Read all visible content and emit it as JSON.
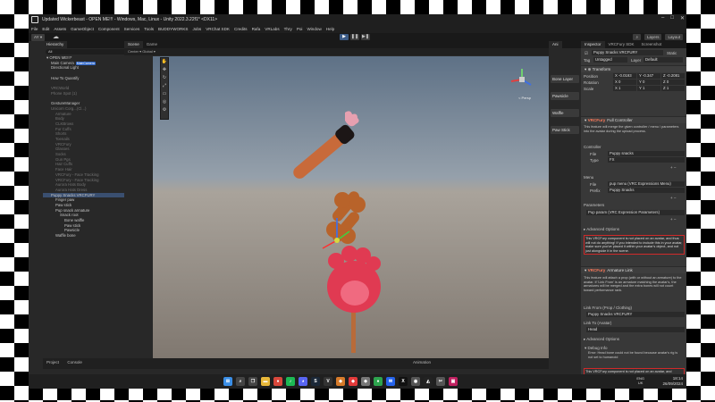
{
  "window": {
    "title": "Updated Wickerbeast - OPEN ME!!! - Windows, Mac, Linux - Unity 2022.3.22f1* <DX11>",
    "controls": [
      "–",
      "□",
      "✕"
    ]
  },
  "menu": [
    "File",
    "Edit",
    "Assets",
    "GameObject",
    "Component",
    "Services",
    "Tools",
    "BUDDYWORKS",
    "Jobs",
    "VRChat SDK",
    "Credits",
    "Rafa",
    "VRLabs",
    "Thry",
    "Poi",
    "Window",
    "Help"
  ],
  "toolbar": {
    "account": "AY ▾",
    "layers": "Layers",
    "layout": "Layout"
  },
  "hierarchy": {
    "tabs": [
      "Hierarchy"
    ],
    "search_placeholder": "All",
    "rows": [
      {
        "label": "▾ OPEN ME!!!*",
        "indent": 0,
        "dim": false,
        "badge": ""
      },
      {
        "label": "Main Camera",
        "indent": 1,
        "dim": false,
        "badge": "MainCamera"
      },
      {
        "label": "Directional Light",
        "indent": 1,
        "dim": false,
        "badge": ""
      },
      {
        "label": "",
        "indent": 1,
        "dim": true,
        "badge": ""
      },
      {
        "label": "How To Quantify",
        "indent": 1,
        "dim": false,
        "badge": ""
      },
      {
        "label": "",
        "indent": 1,
        "dim": true,
        "badge": ""
      },
      {
        "label": "VRCWorld",
        "indent": 1,
        "dim": true,
        "badge": ""
      },
      {
        "label": "Phone Spot (1)",
        "indent": 1,
        "dim": true,
        "badge": ""
      },
      {
        "label": "",
        "indent": 1,
        "dim": true,
        "badge": ""
      },
      {
        "label": "GestureManager",
        "indent": 1,
        "dim": false,
        "badge": ""
      },
      {
        "label": "Unicorn Corg...(Cl...)",
        "indent": 1,
        "dim": true,
        "badge": ""
      },
      {
        "label": "Armature",
        "indent": 2,
        "dim": true,
        "badge": ""
      },
      {
        "label": "Body",
        "indent": 2,
        "dim": true,
        "badge": ""
      },
      {
        "label": "CLKBrows",
        "indent": 2,
        "dim": true,
        "badge": ""
      },
      {
        "label": "Fur Cuffs",
        "indent": 2,
        "dim": true,
        "badge": ""
      },
      {
        "label": "Shorts",
        "indent": 2,
        "dim": true,
        "badge": ""
      },
      {
        "label": "Toenails",
        "indent": 2,
        "dim": true,
        "badge": ""
      },
      {
        "label": "VRCFury",
        "indent": 2,
        "dim": true,
        "badge": ""
      },
      {
        "label": "Glasses",
        "indent": 2,
        "dim": true,
        "badge": ""
      },
      {
        "label": "Socks",
        "indent": 2,
        "dim": true,
        "badge": ""
      },
      {
        "label": "Gun Pgs",
        "indent": 2,
        "dim": true,
        "badge": ""
      },
      {
        "label": "Hair Cuffs",
        "indent": 2,
        "dim": true,
        "badge": ""
      },
      {
        "label": "Face Hair",
        "indent": 2,
        "dim": true,
        "badge": ""
      },
      {
        "label": "VRCFury - Face Tracking",
        "indent": 2,
        "dim": true,
        "badge": ""
      },
      {
        "label": "VRCFury - Face Tracking",
        "indent": 2,
        "dim": true,
        "badge": ""
      },
      {
        "label": "Aurora Hats Body",
        "indent": 2,
        "dim": true,
        "badge": ""
      },
      {
        "label": "Aurora Hats Dress",
        "indent": 2,
        "dim": true,
        "badge": ""
      },
      {
        "label": "Puppy Snacks VRCFURY",
        "indent": 1,
        "dim": false,
        "badge": "",
        "selected": true
      },
      {
        "label": "Finger paw",
        "indent": 2,
        "dim": false,
        "badge": ""
      },
      {
        "label": "Paw stick",
        "indent": 2,
        "dim": false,
        "badge": ""
      },
      {
        "label": "Pup snack armature",
        "indent": 2,
        "dim": false,
        "badge": ""
      },
      {
        "label": "Snack root",
        "indent": 3,
        "dim": false,
        "badge": ""
      },
      {
        "label": "Bone waffle",
        "indent": 4,
        "dim": false,
        "badge": ""
      },
      {
        "label": "Paw stick",
        "indent": 4,
        "dim": false,
        "badge": ""
      },
      {
        "label": "Pawsicle",
        "indent": 4,
        "dim": false,
        "badge": ""
      },
      {
        "label": "Waffle bone",
        "indent": 2,
        "dim": false,
        "badge": ""
      }
    ]
  },
  "scene": {
    "tabs": [
      "Scene",
      "Game"
    ],
    "toolbar_text": "Center ▾   Global ▾",
    "persp_label": "< Persp"
  },
  "side_buttons": [
    "Bone Layer",
    "Pawsicle",
    "Waffle",
    "Paw Stick"
  ],
  "inspector": {
    "tabs": [
      "Inspector",
      "VRCFury SDK",
      "Screenshot"
    ],
    "object_name": "Puppy Snacks VRCFURY",
    "static_label": "Static",
    "tag_label": "Tag",
    "tag_value": "Untagged",
    "layer_label": "Layer",
    "layer_value": "Default",
    "transform": {
      "title": "Transform",
      "position": {
        "label": "Position",
        "x": "X -0.0193",
        "y": "Y -0.347",
        "z": "Z -0.2081"
      },
      "rotation": {
        "label": "Rotation",
        "x": "X 0",
        "y": "Y 0",
        "z": "Z 0"
      },
      "scale": {
        "label": "Scale",
        "x": "X 1",
        "y": "Y 1",
        "z": "Z 1"
      }
    },
    "fc": {
      "tag": "VRCFury",
      "title": "Full Controller",
      "desc": "This feature will merge the given controller / menu / parameters into the avatar during the upload process.",
      "controller_label": "Controller",
      "file_label": "File",
      "file_value": "Puppy snacks",
      "type_label": "Type",
      "type_value": "FX",
      "menu_label": "Menu",
      "menu_file": "pup menu (VRC Expressions Menu)",
      "prefix_label": "Prefix",
      "prefix_value": "Puppy Snacks",
      "params_label": "Parameters",
      "params_value": "Pup param (VRC Expression Parameters)",
      "advanced": "▸ Advanced Options",
      "warning": "This VRCFury component is not placed on an avatar, and thus will not do anything! If you intended to include this in your avatar, make sure you've placed it within your avatar's object, and not just alongside it in the scene."
    },
    "al": {
      "tag": "VRCFury",
      "title": "Armature Link",
      "desc": "This feature will attach a prop (with or without an armature) to the avatar. If 'Link From' is an armature matching the avatar's, the armatures will be merged and the extra bones will not count toward performance rank.",
      "link_from_label": "Link From (Prop / Clothing)",
      "link_from_value": "Puppy Snacks VRCFURY",
      "link_to_label": "Link To (Avatar)",
      "link_to_value": "Head",
      "advanced": "▸ Advanced Options",
      "debug_title": "Debug Info",
      "debug_text": "Error: Head bone could not be found because avatar's rig is not set to humanoid",
      "warning": "This VRCFury component is not placed on an avatar, and"
    }
  },
  "bottom": {
    "tabs": [
      "Project",
      "Console"
    ],
    "anim_tab": "Animation"
  },
  "taskbar": {
    "icons": [
      {
        "name": "windows",
        "label": "⊞",
        "color": "#3a8ee6"
      },
      {
        "name": "search",
        "label": "⌕",
        "color": "#444"
      },
      {
        "name": "taskview",
        "label": "❐",
        "color": "#444"
      },
      {
        "name": "explorer",
        "label": "▬",
        "color": "#e8b83a"
      },
      {
        "name": "chrome",
        "label": "●",
        "color": "#d9473b"
      },
      {
        "name": "spotify",
        "label": "♪",
        "color": "#1db954"
      },
      {
        "name": "discord",
        "label": "◕",
        "color": "#5865f2"
      },
      {
        "name": "steam",
        "label": "S",
        "color": "#1b2838"
      },
      {
        "name": "vrchat",
        "label": "V",
        "color": "#333"
      },
      {
        "name": "app1",
        "label": "◆",
        "color": "#d77b2a"
      },
      {
        "name": "app2",
        "label": "◆",
        "color": "#e23a3a"
      },
      {
        "name": "app3",
        "label": "◆",
        "color": "#777"
      },
      {
        "name": "app4",
        "label": "●",
        "color": "#2da44e"
      },
      {
        "name": "app5",
        "label": "✉",
        "color": "#2563eb"
      },
      {
        "name": "app6",
        "label": "X",
        "color": "#111"
      },
      {
        "name": "app7",
        "label": "◉",
        "color": "#555"
      },
      {
        "name": "unity",
        "label": "◭",
        "color": "#222"
      },
      {
        "name": "snipping",
        "label": "✂",
        "color": "#555"
      },
      {
        "name": "app8",
        "label": "▣",
        "color": "#c02060"
      }
    ],
    "lang": [
      "ENG",
      "UK"
    ],
    "time": "18:14",
    "date": "26/09/2024"
  }
}
